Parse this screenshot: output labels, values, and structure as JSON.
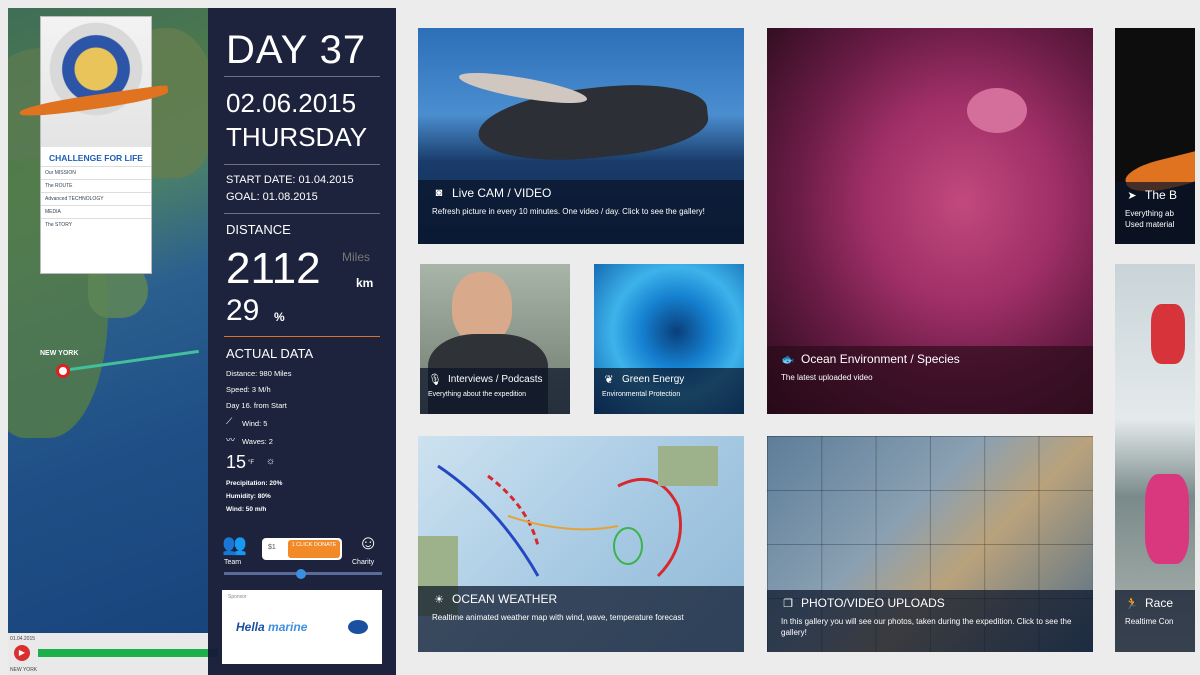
{
  "map": {
    "logo_title": "CHALLENGE FOR LIFE",
    "menu": [
      "Our MISSION",
      "The ROUTE",
      "Advanced TECHNOLOGY",
      "MEDIA",
      "The STORY"
    ],
    "city": "NEW YORK",
    "timeline_start": "01.04.2015",
    "timeline_label": "NEW YORK"
  },
  "panel": {
    "day": "DAY 37",
    "date": "02.06.2015",
    "weekday": "THURSDAY",
    "start_date": "START DATE: 01.04.2015",
    "goal": "GOAL: 01.08.2015",
    "distance_label": "DISTANCE",
    "distance_value": "2112",
    "distance_unit_miles": "Miles",
    "distance_unit_km": "km",
    "percent_value": "29",
    "percent_sign": "%",
    "actual_label": "ACTUAL DATA",
    "actual_distance": "Distance: 980 Miles",
    "speed": "Speed: 3 M/h",
    "day_from_start": "Day 16. from Start",
    "wind": "Wind: 5",
    "waves": "Waves: 2",
    "temperature": "15",
    "temperature_unit": "°F",
    "precipitation": "Precipitation: 20%",
    "humidity": "Humidity: 80%",
    "wind_speed": "Wind: 50 m/h",
    "team_label": "Team",
    "charity_label": "Charity",
    "donate_amount": "$1",
    "donate_button": "1 CLICK DONATE",
    "sponsor_label": "Sponsor",
    "sponsor_name": "Hella",
    "sponsor_name2": "marine"
  },
  "tiles": {
    "livecam": {
      "title": "Live CAM / VIDEO",
      "subtitle": "Refresh picture in every 10 minutes. One video / day. Click to see the gallery!"
    },
    "ocean_env": {
      "title": "Ocean Environment / Species",
      "subtitle": "The latest uploaded video"
    },
    "boat": {
      "title": "The B",
      "subtitle": "Everything ab Used material"
    },
    "interviews": {
      "title": "Interviews / Podcasts",
      "subtitle": "Everything about the expedition"
    },
    "green": {
      "title": "Green Energy",
      "subtitle": "Environmental Protection"
    },
    "weather": {
      "title": "OCEAN WEATHER",
      "subtitle": "Realtime animated weather map with wind, wave, temperature forecast"
    },
    "photos": {
      "title": "PHOTO/VIDEO UPLOADS",
      "subtitle": "In this gallery you will see our photos, taken during the expedition. Click to see the gallery!"
    },
    "race": {
      "title": "Race",
      "subtitle": "Realtime Con"
    }
  },
  "colors": {
    "panel_bg": "#141a34",
    "donate": "#f28a28",
    "timeline": "#1db04a",
    "pin": "#e02020"
  }
}
